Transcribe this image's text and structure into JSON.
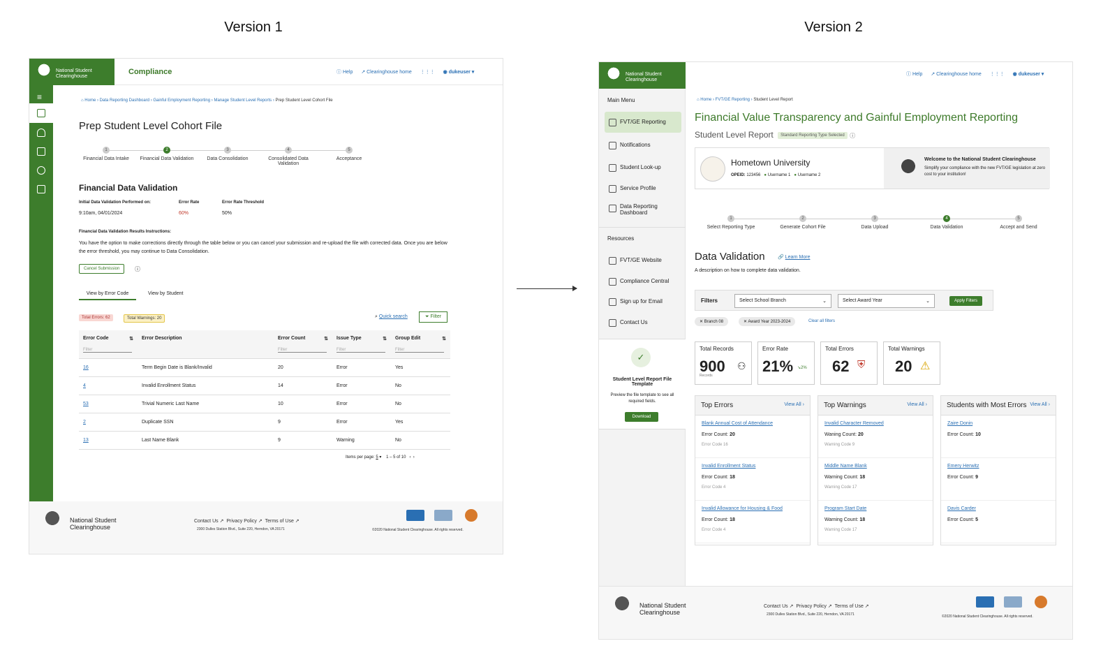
{
  "titles": {
    "v1": "Version 1",
    "v2": "Version 2"
  },
  "v1": {
    "brand": "National Student Clearinghouse",
    "app": "Compliance",
    "nav": {
      "help": "Help",
      "home": "Clearinghouse home",
      "user": "dukeuser"
    },
    "crumbs": [
      "Home",
      "Data Reporting Dashboard",
      "Gainful Employment Reporting",
      "Manage Student Level Reports",
      "Prep Student Level Cohort File"
    ],
    "title": "Prep Student Level Cohort File",
    "steps": [
      {
        "n": "1",
        "l": "Financial Data Intake"
      },
      {
        "n": "2",
        "l": "Financial Data Validation"
      },
      {
        "n": "3",
        "l": "Data Consolidation"
      },
      {
        "n": "4",
        "l": "Consolidated Data Validation"
      },
      {
        "n": "5",
        "l": "Acceptance"
      }
    ],
    "section": "Financial Data Validation",
    "perf_l": "Initial Data Validation Performed on:",
    "perf_v": "9:10am, 04/01/2024",
    "rate_l": "Error Rate",
    "rate_v": "60%",
    "thr_l": "Error Rate Threshold",
    "thr_v": "50%",
    "instr_h": "Financial Data Validation Results Instructions:",
    "instr": "You have the option to make corrections directly through the table below or you can cancel your submission and re-upload the file with corrected data. Once you are below the error threshold, you may continue to Data Consolidation.",
    "cancel": "Cancel Submission",
    "tabs": [
      "View by Error Code",
      "View by Student"
    ],
    "errors": "Total Errors: 62",
    "warnings": "Total Warnings: 20",
    "quick": "Quick search",
    "filter": "Filter",
    "cols": [
      "Error Code",
      "Error Description",
      "Error Count",
      "Issue Type",
      "Group Edit"
    ],
    "filter_ph": "Filter",
    "rows": [
      [
        "16",
        "Term Begin Date is Blank/Invalid",
        "20",
        "Error",
        "Yes"
      ],
      [
        "4",
        "Invalid Enrollment Status",
        "14",
        "Error",
        "No"
      ],
      [
        "53",
        "Trivial Numeric Last Name",
        "10",
        "Error",
        "No"
      ],
      [
        "2",
        "Duplicate SSN",
        "9",
        "Error",
        "Yes"
      ],
      [
        "13",
        "Last Name Blank",
        "9",
        "Warning",
        "No"
      ]
    ],
    "ipp": "Items per page:",
    "ipp_v": "5",
    "range": "1 – 5 of 10",
    "footer": {
      "links": [
        "Contact Us",
        "Privacy Policy",
        "Terms of Use"
      ],
      "addr": "2300 Dulles Station Blvd., Suite 220, Herndon, VA 20171",
      "copy": "©2020 National Student Clearinghouse. All rights reserved."
    }
  },
  "v2": {
    "brand": "National Student Clearinghouse",
    "nav": {
      "help": "Help",
      "home": "Clearinghouse home",
      "user": "dukeuser"
    },
    "main_menu": "Main Menu",
    "menu": [
      "FVT/GE Reporting",
      "Notifications",
      "Student Look-up",
      "Service Profile",
      "Data Reporting Dashboard"
    ],
    "resources": "Resources",
    "res": [
      "FVT/GE Website",
      "Compliance Central",
      "Sign up for Email",
      "Contact Us"
    ],
    "tpl_title": "Student Level Report File Template",
    "tpl_desc": "Preview the file template to see all required fields.",
    "download": "Download",
    "crumbs": [
      "Home",
      "FVT/GE Reporting",
      "Student Level Report"
    ],
    "title": "Financial Value Transparency and Gainful Employment Reporting",
    "subtitle": "Student Level Report",
    "std_badge": "Standard Reporting Type Selected",
    "school": "Hometown University",
    "opeid_l": "OPEID:",
    "opeid": "123456",
    "u1": "Username 1",
    "u2": "Username 2",
    "welcome_h": "Welcome to the National Student Clearinghouse",
    "welcome": "Simplify your compliance with the new FVT/GE legislation at zero cost to your institution!",
    "steps": [
      {
        "n": "1",
        "l": "Select Reporting Type"
      },
      {
        "n": "2",
        "l": "Generate Cohort File"
      },
      {
        "n": "3",
        "l": "Data Upload"
      },
      {
        "n": "4",
        "l": "Data Validation"
      },
      {
        "n": "5",
        "l": "Accept and Send"
      }
    ],
    "section": "Data Validation",
    "learn": "Learn More",
    "desc": "A description on how to complete data validation.",
    "filters": "Filters",
    "branch_ph": "Select School Branch",
    "year_ph": "Select Award Year",
    "apply": "Apply Filters",
    "chips": [
      "Branch 08",
      "Award Year 2023-2024"
    ],
    "clear": "Clear all filters",
    "kpis": [
      {
        "l": "Total Records",
        "v": "900",
        "s": "Records"
      },
      {
        "l": "Error Rate",
        "v": "21%",
        "s": "2%"
      },
      {
        "l": "Total Errors",
        "v": "62"
      },
      {
        "l": "Total Warnings",
        "v": "20"
      }
    ],
    "panels": [
      {
        "t": "Top Errors",
        "va": "View All",
        "items": [
          {
            "l": "Blank Annual Cost of Attendance",
            "c": "Error Count: ",
            "n": "20",
            "s": "Error Code 16"
          },
          {
            "l": "Invalid Enrollment Status",
            "c": "Error Count: ",
            "n": "18",
            "s": "Error Code 4"
          },
          {
            "l": "Invalid Allowance for Housing & Food",
            "c": "Error Count: ",
            "n": "18",
            "s": "Error Code 4"
          }
        ]
      },
      {
        "t": "Top Warnings",
        "va": "View All",
        "items": [
          {
            "l": "Invalid Character Removed",
            "c": "Waning Count: ",
            "n": "20",
            "s": "Warning Code 9"
          },
          {
            "l": "Middle Name Blank",
            "c": "Warning Count: ",
            "n": "18",
            "s": "Warning Code 17"
          },
          {
            "l": "Program Start Date",
            "c": "Warning Count: ",
            "n": "18",
            "s": "Warning Code 17"
          }
        ]
      },
      {
        "t": "Students with Most Errors",
        "va": "View All",
        "items": [
          {
            "l": "Zaire Donin",
            "c": "Error Count: ",
            "n": "10",
            "s": ""
          },
          {
            "l": "Emery Herwitz",
            "c": "Error Count: ",
            "n": "9",
            "s": ""
          },
          {
            "l": "Davis Carder",
            "c": "Error Count: ",
            "n": "5",
            "s": ""
          }
        ]
      }
    ],
    "footer": {
      "links": [
        "Contact Us",
        "Privacy Policy",
        "Terms of Use"
      ],
      "addr": "2300 Dulles Station Blvd., Suite 220, Herndon, VA 20171",
      "copy": "©2020 National Student Clearinghouse. All rights reserved."
    }
  }
}
